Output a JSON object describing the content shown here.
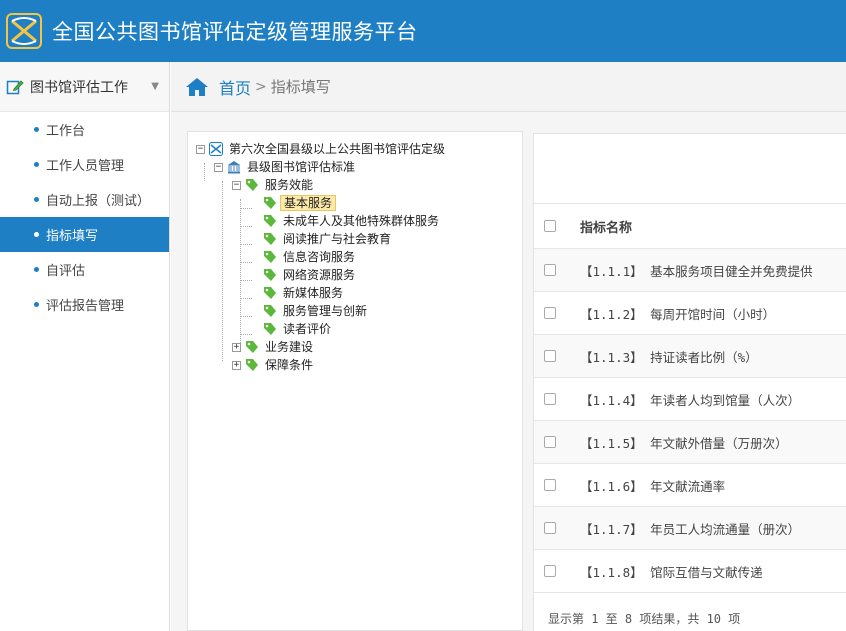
{
  "header": {
    "title": "全国公共图书馆评估定级管理服务平台",
    "brand_color": "#1f7fc4"
  },
  "sidebar": {
    "section_label": "图书馆评估工作",
    "items": [
      {
        "label": "工作台",
        "active": false
      },
      {
        "label": "工作人员管理",
        "active": false
      },
      {
        "label": "自动上报（测试）",
        "active": false
      },
      {
        "label": "指标填写",
        "active": true
      },
      {
        "label": "自评估",
        "active": false
      },
      {
        "label": "评估报告管理",
        "active": false
      }
    ]
  },
  "breadcrumb": {
    "home": "首页",
    "separator": ">",
    "current": "指标填写"
  },
  "tree": {
    "root": "第六次全国县级以上公共图书馆评估定级",
    "standard": "县级图书馆评估标准",
    "group1": "服务效能",
    "children": [
      "基本服务",
      "未成年人及其他特殊群体服务",
      "阅读推广与社会教育",
      "信息咨询服务",
      "网络资源服务",
      "新媒体服务",
      "服务管理与创新",
      "读者评价"
    ],
    "group2": "业务建设",
    "group3": "保障条件"
  },
  "table": {
    "header": "指标名称",
    "rows": [
      "【1.1.1】 基本服务项目健全并免费提供",
      "【1.1.2】 每周开馆时间（小时）",
      "【1.1.3】 持证读者比例（%）",
      "【1.1.4】 年读者人均到馆量（人次）",
      "【1.1.5】 年文献外借量（万册次）",
      "【1.1.6】 年文献流通率",
      "【1.1.7】 年员工人均流通量（册次）",
      "【1.1.8】 馆际互借与文献传递"
    ],
    "footer": "显示第 1 至 8 项结果，共 10 项"
  }
}
